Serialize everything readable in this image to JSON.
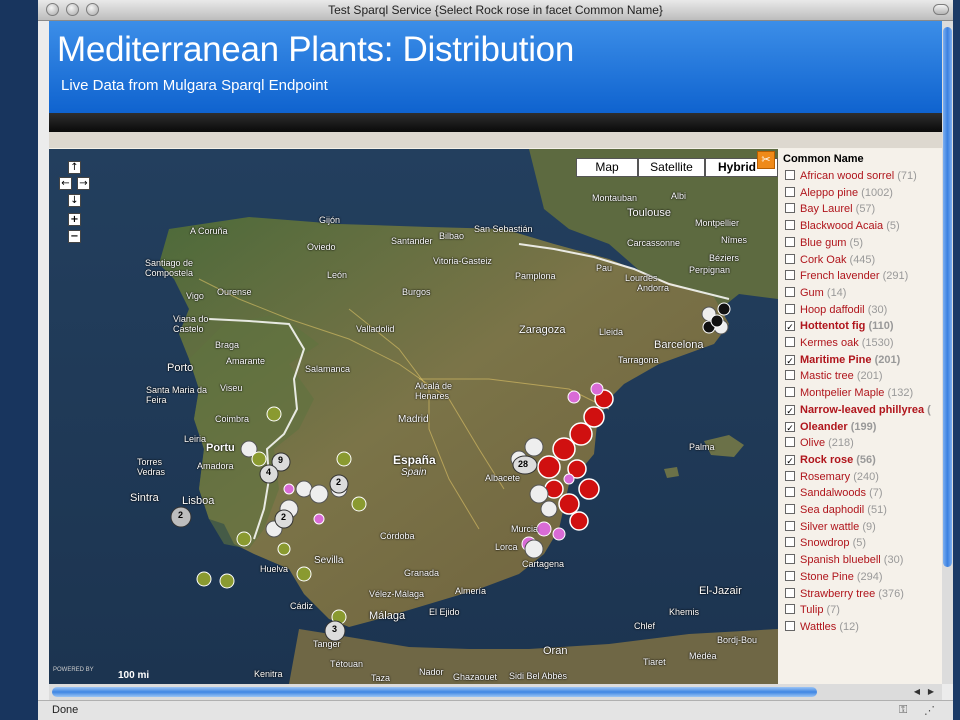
{
  "window": {
    "title": "Test Sparql Service {Select Rock rose in facet Common Name}"
  },
  "header": {
    "title": "Mediterranean Plants: Distribution",
    "subtitle": "Live Data from Mulgara Sparql Endpoint"
  },
  "map": {
    "type_buttons": [
      "Map",
      "Satellite",
      "Hybrid"
    ],
    "selected_type": "Hybrid",
    "powered_by": "POWERED BY",
    "scale": "100 mi",
    "cities": [
      {
        "name": "A Coruña"
      },
      {
        "name": "Gijón"
      },
      {
        "name": "Oviedo"
      },
      {
        "name": "Santander"
      },
      {
        "name": "Bilbao"
      },
      {
        "name": "San Sebastián"
      },
      {
        "name": "Toulouse"
      },
      {
        "name": "Albi"
      },
      {
        "name": "Montauban"
      },
      {
        "name": "Montpellier"
      },
      {
        "name": "Carcassonne"
      },
      {
        "name": "Nîmes"
      },
      {
        "name": "Perpignan"
      },
      {
        "name": "Béziers"
      },
      {
        "name": "Santiago de Compostela"
      },
      {
        "name": "León"
      },
      {
        "name": "Vitoria-Gasteiz"
      },
      {
        "name": "Pamplona"
      },
      {
        "name": "Pau"
      },
      {
        "name": "Lourdes"
      },
      {
        "name": "Ourense"
      },
      {
        "name": "Vigo"
      },
      {
        "name": "Burgos"
      },
      {
        "name": "Andorra"
      },
      {
        "name": "Viana do Castelo"
      },
      {
        "name": "Braga"
      },
      {
        "name": "Valladolid"
      },
      {
        "name": "Zaragoza"
      },
      {
        "name": "Lleida"
      },
      {
        "name": "Barcelona"
      },
      {
        "name": "Tarragona"
      },
      {
        "name": "Porto"
      },
      {
        "name": "Amarante"
      },
      {
        "name": "Salamanca"
      },
      {
        "name": "Santa Maria da Feira"
      },
      {
        "name": "Viseu"
      },
      {
        "name": "Alcalá de Henares"
      },
      {
        "name": "Madrid"
      },
      {
        "name": "Coimbra"
      },
      {
        "name": "Leiria"
      },
      {
        "name": "Portu"
      },
      {
        "name": "España"
      },
      {
        "name": "Spain"
      },
      {
        "name": "Torres Vedras"
      },
      {
        "name": "Amadora"
      },
      {
        "name": "Palma"
      },
      {
        "name": "Sintra"
      },
      {
        "name": "Lisboa"
      },
      {
        "name": "Albacete"
      },
      {
        "name": "Córdoba"
      },
      {
        "name": "Murcia"
      },
      {
        "name": "Lorca"
      },
      {
        "name": "Sevilla"
      },
      {
        "name": "Cartagena"
      },
      {
        "name": "Granada"
      },
      {
        "name": "Huelva"
      },
      {
        "name": "Almería"
      },
      {
        "name": "Vélez-Málaga"
      },
      {
        "name": "Cádiz"
      },
      {
        "name": "Málaga"
      },
      {
        "name": "El Ejido"
      },
      {
        "name": "El-Jazair"
      },
      {
        "name": "Khemis"
      },
      {
        "name": "Chlef"
      },
      {
        "name": "Bordj-Bou"
      },
      {
        "name": "Tanger"
      },
      {
        "name": "Tétouan"
      },
      {
        "name": "Oran"
      },
      {
        "name": "Kenitra"
      },
      {
        "name": "Nador"
      },
      {
        "name": "Ghazaouet"
      },
      {
        "name": "Sidi Bel Abbès"
      },
      {
        "name": "Tiaret"
      },
      {
        "name": "Médéa"
      },
      {
        "name": "Taza"
      }
    ],
    "clusters": [
      "9",
      "4",
      "2",
      "2",
      "28",
      "2",
      "3"
    ]
  },
  "facet": {
    "heading": "Common Name",
    "items": [
      {
        "name": "African wood sorrel",
        "count": "(71)",
        "checked": false
      },
      {
        "name": "Aleppo pine",
        "count": "(1002)",
        "checked": false
      },
      {
        "name": "Bay Laurel",
        "count": "(57)",
        "checked": false
      },
      {
        "name": "Blackwood Acaia",
        "count": "(5)",
        "checked": false
      },
      {
        "name": "Blue gum",
        "count": "(5)",
        "checked": false
      },
      {
        "name": "Cork Oak",
        "count": "(445)",
        "checked": false
      },
      {
        "name": "French lavender",
        "count": "(291)",
        "checked": false
      },
      {
        "name": "Gum",
        "count": "(14)",
        "checked": false
      },
      {
        "name": "Hoop daffodil",
        "count": "(30)",
        "checked": false
      },
      {
        "name": "Hottentot fig",
        "count": "(110)",
        "checked": true
      },
      {
        "name": "Kermes oak",
        "count": "(1530)",
        "checked": false
      },
      {
        "name": "Maritime Pine",
        "count": "(201)",
        "checked": true
      },
      {
        "name": "Mastic tree",
        "count": "(201)",
        "checked": false
      },
      {
        "name": "Montpelier Maple",
        "count": "(132)",
        "checked": false
      },
      {
        "name": "Narrow-leaved phillyrea",
        "count": "(",
        "checked": true
      },
      {
        "name": "Oleander",
        "count": "(199)",
        "checked": true
      },
      {
        "name": "Olive",
        "count": "(218)",
        "checked": false
      },
      {
        "name": "Rock rose",
        "count": "(56)",
        "checked": true
      },
      {
        "name": "Rosemary",
        "count": "(240)",
        "checked": false
      },
      {
        "name": "Sandalwoods",
        "count": "(7)",
        "checked": false
      },
      {
        "name": "Sea daphodil",
        "count": "(51)",
        "checked": false
      },
      {
        "name": "Silver wattle",
        "count": "(9)",
        "checked": false
      },
      {
        "name": "Snowdrop",
        "count": "(5)",
        "checked": false
      },
      {
        "name": "Spanish bluebell",
        "count": "(30)",
        "checked": false
      },
      {
        "name": "Stone Pine",
        "count": "(294)",
        "checked": false
      },
      {
        "name": "Strawberry tree",
        "count": "(376)",
        "checked": false
      },
      {
        "name": "Tulip",
        "count": "(7)",
        "checked": false
      },
      {
        "name": "Wattles",
        "count": "(12)",
        "checked": false
      }
    ]
  },
  "statusbar": {
    "text": "Done"
  },
  "colors": {
    "header_top": "#3c8ee8",
    "header_bottom": "#0f63cf",
    "facet_link": "#b0151c",
    "facet_count": "#999999",
    "scrollbar": "#3a80e0"
  }
}
